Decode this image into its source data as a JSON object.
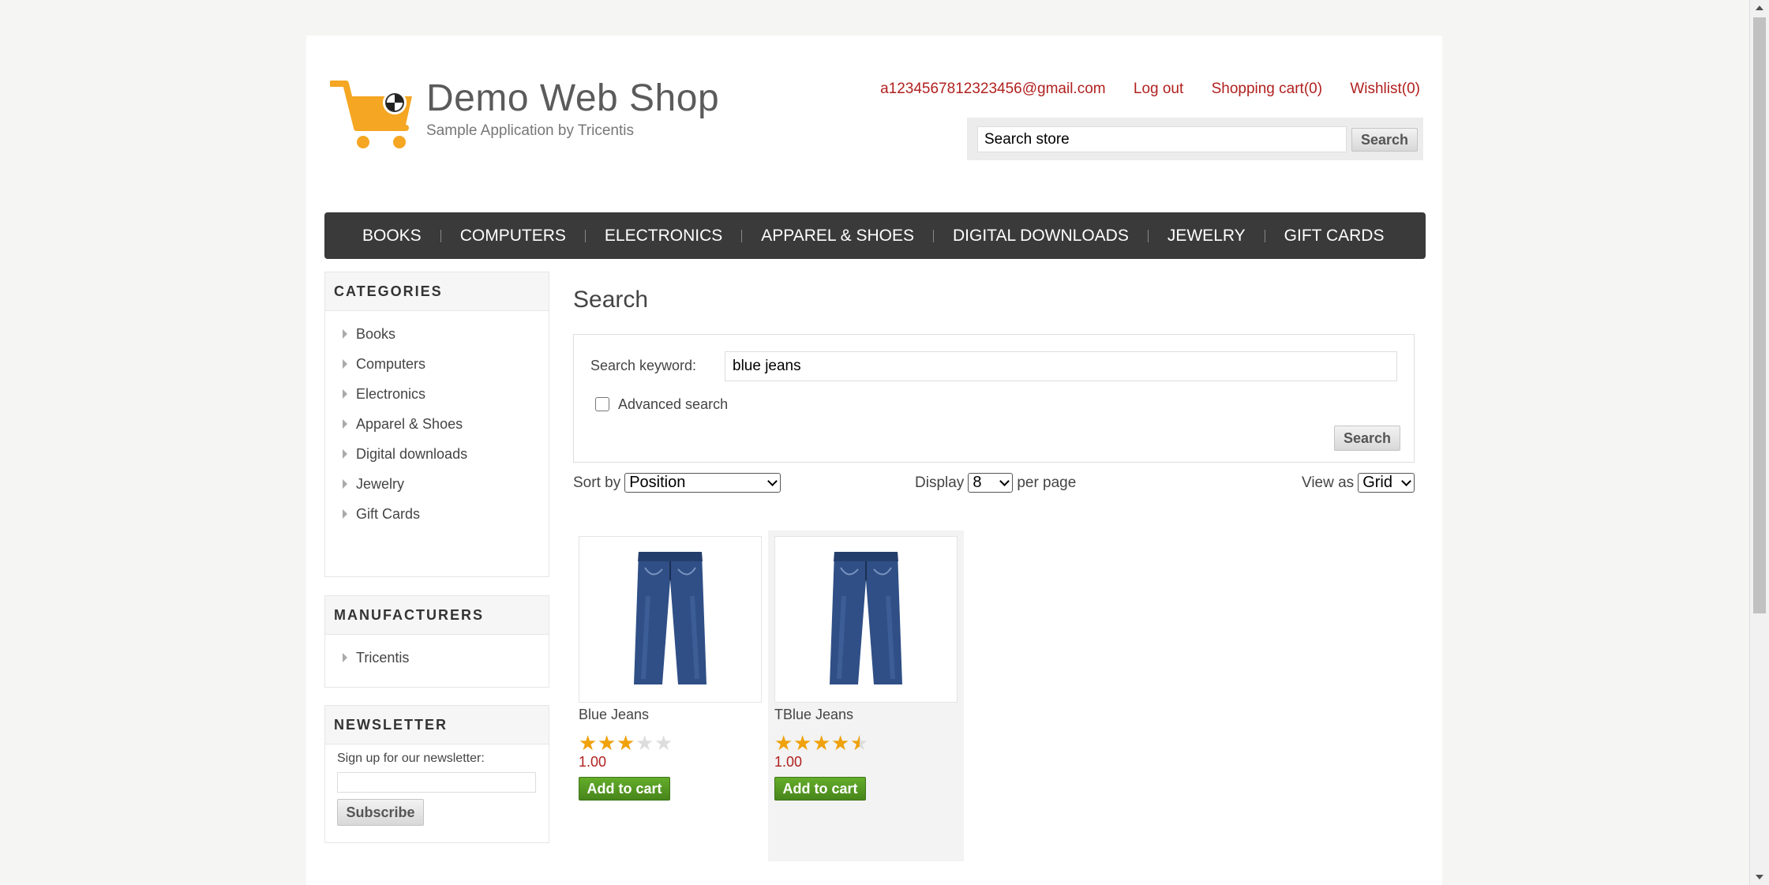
{
  "header": {
    "title": "Demo Web Shop",
    "subtitle": "Sample Application by Tricentis",
    "links": {
      "account": "a1234567812323456@gmail.com",
      "logout": "Log out",
      "cart": "Shopping cart(0)",
      "wishlist": "Wishlist(0)"
    },
    "search": {
      "value": "Search store",
      "button": "Search"
    }
  },
  "nav": [
    "BOOKS",
    "COMPUTERS",
    "ELECTRONICS",
    "APPAREL & SHOES",
    "DIGITAL DOWNLOADS",
    "JEWELRY",
    "GIFT CARDS"
  ],
  "sidebar": {
    "categories": {
      "title": "CATEGORIES",
      "items": [
        "Books",
        "Computers",
        "Electronics",
        "Apparel & Shoes",
        "Digital downloads",
        "Jewelry",
        "Gift Cards"
      ]
    },
    "manufacturers": {
      "title": "MANUFACTURERS",
      "items": [
        "Tricentis"
      ]
    },
    "newsletter": {
      "title": "NEWSLETTER",
      "label": "Sign up for our newsletter:",
      "button": "Subscribe"
    }
  },
  "main": {
    "title": "Search",
    "keyword_label": "Search keyword:",
    "keyword_value": "blue jeans",
    "advanced_label": "Advanced search",
    "search_button": "Search",
    "sort_label": "Sort by",
    "sort_value": "Position",
    "display_label": "Display",
    "display_value": "8",
    "per_page": "per page",
    "view_label": "View as",
    "view_value": "Grid"
  },
  "products": [
    {
      "name": "Blue Jeans",
      "rating": 3,
      "price": "1.00",
      "button": "Add to cart",
      "image": "jeans-image"
    },
    {
      "name": "TBlue Jeans",
      "rating": 4.5,
      "price": "1.00",
      "button": "Add to cart",
      "image": "jeans-image"
    }
  ],
  "colors": {
    "accent": "#b0211f",
    "nav_bg": "#3a3a3a",
    "cart_button": "#55a023",
    "star": "#f0a20c"
  }
}
